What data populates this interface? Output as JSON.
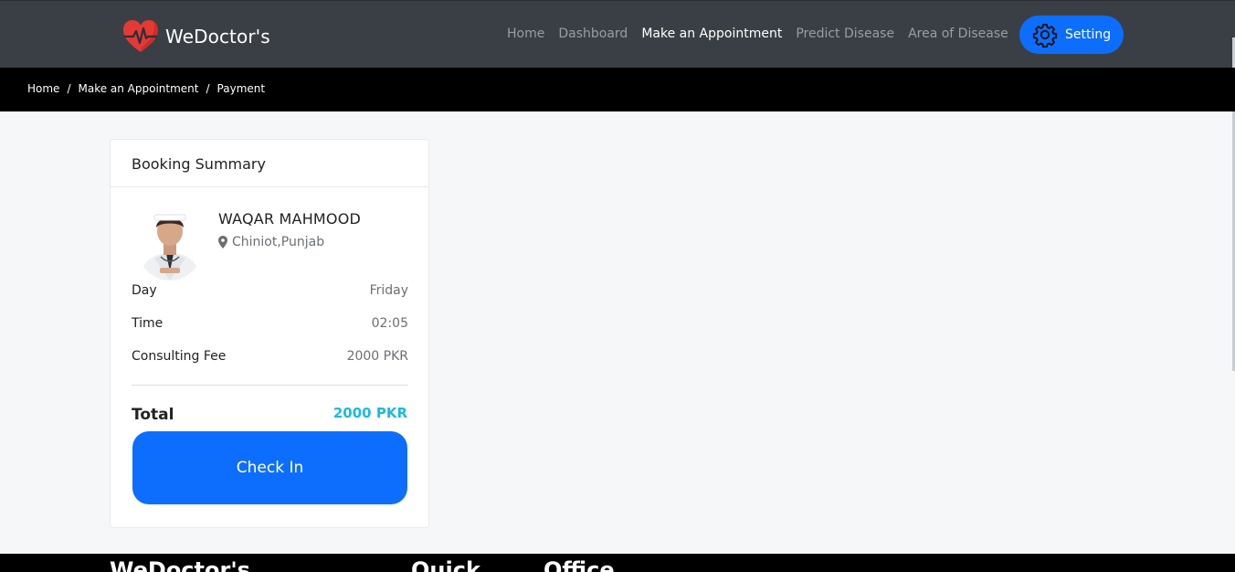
{
  "brand": {
    "name": "WeDoctor's",
    "logo_icon": "heart-pulse-icon",
    "logo_color": "#e53935"
  },
  "nav": {
    "links": [
      {
        "label": "Home",
        "active": false
      },
      {
        "label": "Dashboard",
        "active": false
      },
      {
        "label": "Make an Appointment",
        "active": true
      },
      {
        "label": "Predict Disease",
        "active": false
      },
      {
        "label": "Area of Disease",
        "active": false
      }
    ],
    "setting_label": "Setting",
    "setting_icon": "gear-icon"
  },
  "breadcrumb": [
    "Home",
    "Make an Appointment",
    "Payment"
  ],
  "booking": {
    "title": "Booking Summary",
    "doctor": {
      "name": "WAQAR MAHMOOD",
      "location": "Chiniot,Punjab",
      "location_icon": "map-marker-icon"
    },
    "rows": [
      {
        "label": "Day",
        "value": "Friday"
      },
      {
        "label": "Time",
        "value": "02:05"
      },
      {
        "label": "Consulting Fee",
        "value": "2000 PKR"
      }
    ],
    "total_label": "Total",
    "total_value": "2000 PKR",
    "checkin_label": "Check In"
  },
  "footer": {
    "headings": [
      "WeDoctor's",
      "Quick",
      "Office"
    ]
  },
  "colors": {
    "primary": "#0d6efd",
    "navbar": "#3a3f45",
    "total": "#1cb8e6"
  }
}
